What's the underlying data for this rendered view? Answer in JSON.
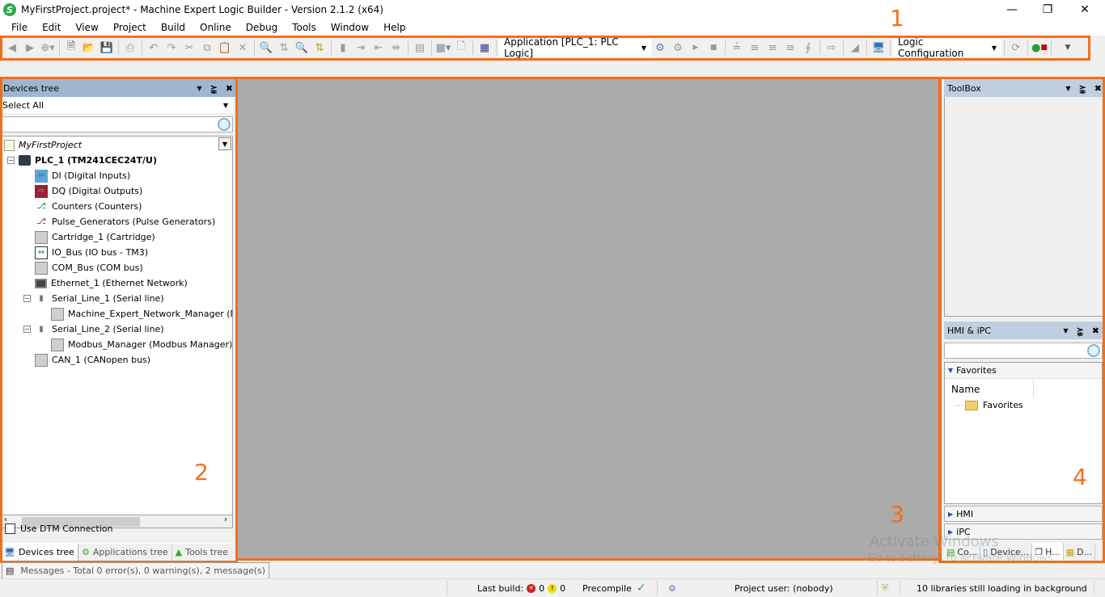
{
  "window": {
    "title": "MyFirstProject.project* - Machine Expert Logic Builder - Version 2.1.2 (x64)",
    "minimize_icon": "minimize-icon",
    "restore_icon": "restore-icon",
    "close_icon": "close-icon"
  },
  "menu": [
    "File",
    "Edit",
    "View",
    "Project",
    "Build",
    "Online",
    "Debug",
    "Tools",
    "Window",
    "Help"
  ],
  "toolbar": {
    "application_combo": "Application [PLC_1: PLC Logic]",
    "configuration_combo": "Logic Configuration"
  },
  "annotations": {
    "n1": "1",
    "n2": "2",
    "n3": "3",
    "n4": "4",
    "accent_color": "#f26f1a"
  },
  "devices_panel": {
    "title": "Devices tree",
    "filter_value": "Select All",
    "search_placeholder": "",
    "tree": [
      {
        "label": "MyFirstProject",
        "icon": "project-icon"
      },
      {
        "label": "PLC_1 (TM241CEC24T/U)",
        "icon": "plc-icon"
      },
      {
        "label": "DI (Digital Inputs)",
        "icon": "digital-inputs-icon"
      },
      {
        "label": "DQ (Digital Outputs)",
        "icon": "digital-outputs-icon"
      },
      {
        "label": "Counters (Counters)",
        "icon": "counters-icon"
      },
      {
        "label": "Pulse_Generators (Pulse Generators)",
        "icon": "pulse-generators-icon"
      },
      {
        "label": "Cartridge_1 (Cartridge)",
        "icon": "module-icon"
      },
      {
        "label": "IO_Bus (IO bus - TM3)",
        "icon": "io-bus-icon"
      },
      {
        "label": "COM_Bus (COM bus)",
        "icon": "module-icon"
      },
      {
        "label": "Ethernet_1 (Ethernet Network)",
        "icon": "ethernet-icon"
      },
      {
        "label": "Serial_Line_1 (Serial line)",
        "icon": "serial-line-icon"
      },
      {
        "label": "Machine_Expert_Network_Manager (Mach",
        "icon": "module-icon"
      },
      {
        "label": "Serial_Line_2 (Serial line)",
        "icon": "serial-line-icon"
      },
      {
        "label": "Modbus_Manager (Modbus Manager)",
        "icon": "module-icon"
      },
      {
        "label": "CAN_1 (CANopen bus)",
        "icon": "module-icon"
      }
    ],
    "dtm_label": "Use DTM Connection",
    "dtm_checked": false,
    "tabs": [
      "Devices tree",
      "Applications tree",
      "Tools tree"
    ],
    "active_tab": "Devices tree"
  },
  "toolbox_panel": {
    "title": "ToolBox"
  },
  "hmi_panel": {
    "title": "HMI & iPC",
    "favorites_section": "Favorites",
    "name_column": "Name",
    "favorites_item": "Favorites",
    "hmi_section": "HMI",
    "ipc_section": "iPC",
    "tabs": [
      "Co...",
      "Device...",
      "H...",
      "D..."
    ],
    "active_tab": "H..."
  },
  "messages_tab": "Messages - Total 0 error(s), 0 warning(s), 2 message(s)",
  "statusbar": {
    "last_build_label": "Last build:",
    "errors": "0",
    "warnings": "0",
    "precompile_label": "Precompile",
    "project_user": "Project user: (nobody)",
    "libraries": "10 libraries still loading in background"
  },
  "watermark": {
    "line1": "Activate Windows",
    "line2": "Go to Settings to activate Windows."
  }
}
